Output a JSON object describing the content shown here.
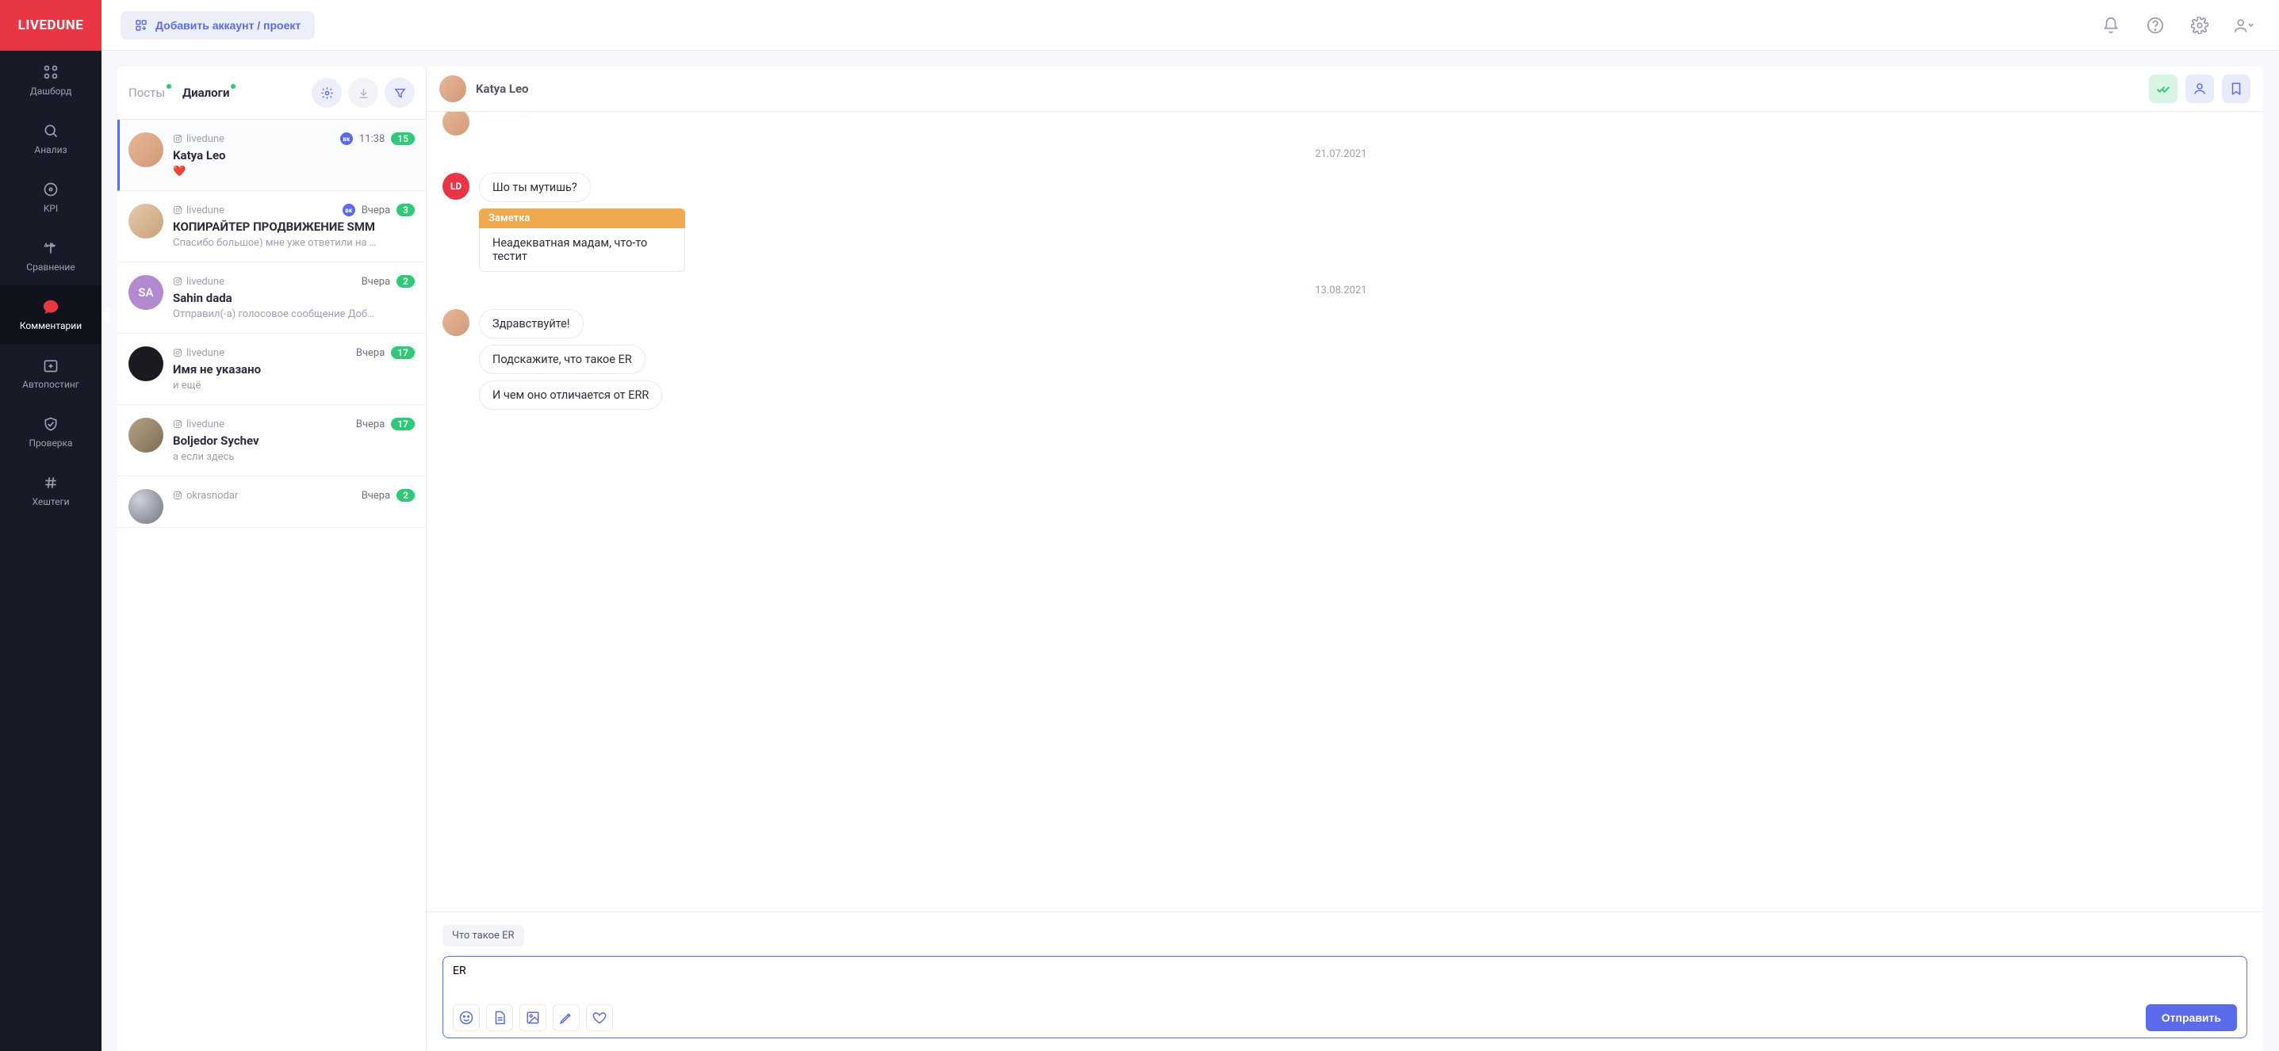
{
  "brand": "LIVEDUNE",
  "topbar": {
    "add_account": "Добавить аккаунт / проект"
  },
  "sidebar": {
    "dashboard": "Дашборд",
    "analysis": "Анализ",
    "kpi": "KPI",
    "compare": "Сравнение",
    "comments": "Комментарии",
    "autoposting": "Автопостинг",
    "check": "Проверка",
    "hashtags": "Хештеги"
  },
  "tabs": {
    "posts": "Посты",
    "dialogs": "Диалоги"
  },
  "dialogs": [
    {
      "channel": "livedune",
      "name": "Katya Leo",
      "preview": "❤️",
      "time": "11:38",
      "count": "15",
      "vk": true
    },
    {
      "channel": "livedune",
      "name": "КОПИРАЙТЕР ПРОДВИЖЕНИЕ SMM",
      "preview": "Спасибо большое) мне уже ответили на …",
      "time": "Вчера",
      "count": "3",
      "vk": true
    },
    {
      "channel": "livedune",
      "name": "Sahin dada",
      "preview": "Отправил(-а) голосовое сообщение Доб…",
      "time": "Вчера",
      "count": "2",
      "initials": "SA"
    },
    {
      "channel": "livedune",
      "name": "Имя не указано",
      "preview": "и ещё",
      "time": "Вчера",
      "count": "17"
    },
    {
      "channel": "livedune",
      "name": "Boljedor Sychev",
      "preview": "а если здесь",
      "time": "Вчера",
      "count": "17"
    },
    {
      "channel": "okrasnodar",
      "name": "",
      "preview": "",
      "time": "Вчера",
      "count": "2"
    }
  ],
  "chat": {
    "name": "Katya Leo",
    "date1": "21.07.2021",
    "date2": "13.08.2021",
    "ld_initials": "LD",
    "messages": {
      "m1": "Шо ты мутишь?",
      "note_label": "Заметка",
      "note_body": "Неадекватная мадам, что-то тестит",
      "m2": "Здравствуйте!",
      "m3": "Подскажите, что такое ER",
      "m4": "И чем оно отличается от ERR"
    },
    "suggest": "Что такое ER",
    "input_value": "ER",
    "send": "Отправить"
  }
}
